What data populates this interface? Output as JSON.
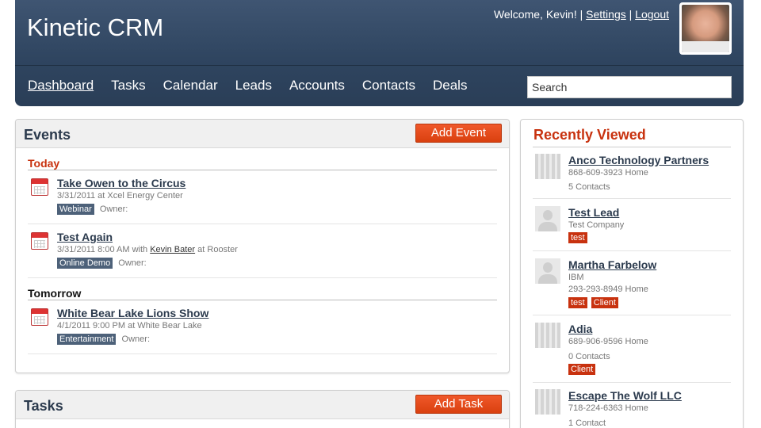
{
  "header": {
    "brand": "Kinetic CRM",
    "welcome": "Welcome, Kevin!",
    "settings": "Settings",
    "logout": "Logout",
    "sep": "|"
  },
  "nav": {
    "items": [
      "Dashboard",
      "Tasks",
      "Calendar",
      "Leads",
      "Accounts",
      "Contacts",
      "Deals"
    ],
    "active": "Dashboard"
  },
  "search": {
    "value": "Search"
  },
  "events": {
    "title": "Events",
    "add_label": "Add Event",
    "groups": [
      {
        "label": "Today",
        "items": [
          {
            "title": "Take Owen to the Circus",
            "meta": "3/31/2011 at Xcel Energy Center",
            "tag": "Webinar",
            "owner": "Owner:"
          },
          {
            "title": "Test Again",
            "meta_pre": "3/31/2011 8:00 AM with",
            "meta_link": "Kevin Bater",
            "meta_post": "at Rooster",
            "tag": "Online Demo",
            "owner": "Owner:"
          }
        ]
      },
      {
        "label": "Tomorrow",
        "items": [
          {
            "title": "White Bear Lake Lions Show",
            "meta": "4/1/2011 9:00 PM at White Bear Lake",
            "tag": "Entertainment",
            "owner": "Owner:"
          }
        ]
      }
    ]
  },
  "tasks": {
    "title": "Tasks",
    "add_label": "Add Task"
  },
  "recently_viewed": {
    "title": "Recently Viewed",
    "items": [
      {
        "name": "Anco Technology Partners",
        "line1": "868-609-3923 Home",
        "line2": "5 Contacts",
        "thumb": "building-icon"
      },
      {
        "name": "Test Lead",
        "line1": "Test Company",
        "tags": [
          "test"
        ],
        "thumb": "person-icon"
      },
      {
        "name": "Martha Farbelow",
        "line1": "IBM",
        "line2": "293-293-8949 Home",
        "tags": [
          "test",
          "Client"
        ],
        "thumb": "person-icon"
      },
      {
        "name": "Adia",
        "line1": "689-906-9596 Home",
        "line2": "0 Contacts",
        "tags": [
          "Client"
        ],
        "thumb": "building-icon"
      },
      {
        "name": "Escape The Wolf LLC",
        "line1": "718-224-6363 Home",
        "line2": "1 Contact",
        "thumb": "building-icon"
      }
    ]
  },
  "colors": {
    "header_bg": "#2f4560",
    "accent_orange": "#d9400f",
    "tag_slate": "#4d6179",
    "tag_red": "#c8320f",
    "today_label": "#c8320f"
  }
}
